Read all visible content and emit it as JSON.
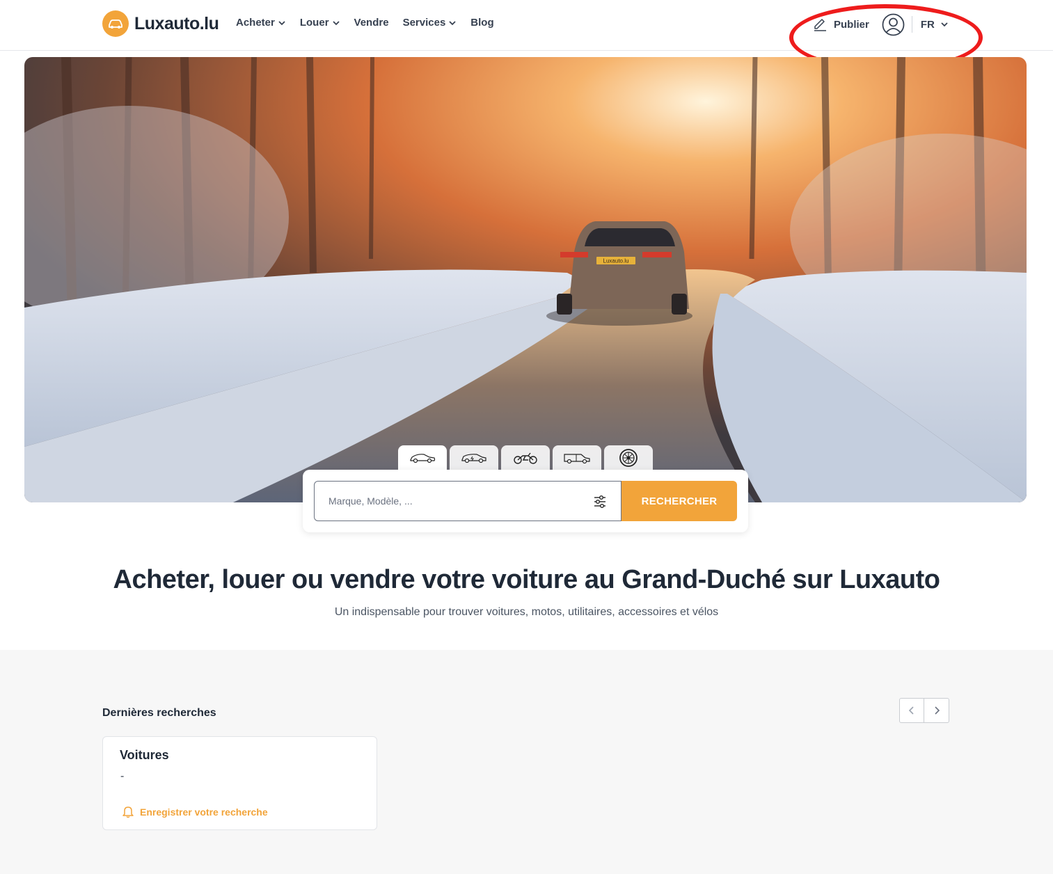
{
  "brand": {
    "name": "Luxauto.lu",
    "accent": "#f2a43a"
  },
  "nav": {
    "buy": "Acheter",
    "rent": "Louer",
    "sell": "Vendre",
    "services": "Services",
    "blog": "Blog"
  },
  "header_actions": {
    "publish": "Publier",
    "language": "FR"
  },
  "hero": {
    "plate_text": "Luxauto.lu",
    "vehicle_tabs": [
      "car-icon",
      "electric-car-icon",
      "motorcycle-icon",
      "van-icon",
      "wheel-icon"
    ]
  },
  "search": {
    "placeholder": "Marque, Modèle, ...",
    "button": "RECHERCHER"
  },
  "headline": {
    "title": "Acheter, louer ou vendre votre voiture au Grand-Duché sur Luxauto",
    "subtitle": "Un indispensable pour trouver voitures, motos, utilitaires, accessoires et vélos"
  },
  "recent_searches": {
    "title": "Dernières recherches",
    "cards": [
      {
        "title": "Voitures",
        "value": "-",
        "save_label": "Enregistrer votre recherche"
      }
    ]
  },
  "annotation_color": "#ee1c1c"
}
